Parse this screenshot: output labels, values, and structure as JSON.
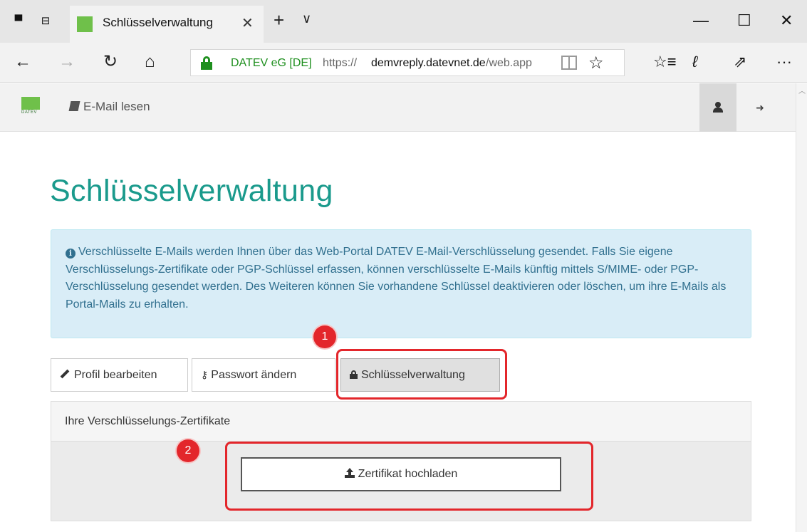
{
  "browser": {
    "tab_title": "Schlüsselverwaltung",
    "tab_close": "✕",
    "new_tab": "+",
    "tab_menu": "∨",
    "window_controls": {
      "minimize": "—",
      "maximize": "☐",
      "close": "✕"
    },
    "nav": {
      "back": "←",
      "forward": "→",
      "refresh": "↻",
      "home": "⌂"
    },
    "address": {
      "org": "DATEV eG [DE]",
      "scheme": "https://",
      "host": "demvreply.datevnet.de",
      "path": "/web.app"
    },
    "favorite_icon": "☆",
    "toolbar": {
      "favorites": "☆≡",
      "notes": "ℓ",
      "share": "⇗",
      "more": "···"
    }
  },
  "app": {
    "logo_text": "DATEV",
    "nav_read_mail": "E-Mail lesen",
    "logout_glyph": "➜"
  },
  "page": {
    "title": "Schlüsselverwaltung",
    "info_icon": "i",
    "info_text": "Verschlüsselte E-Mails werden Ihnen über das Web-Portal DATEV E-Mail-Verschlüsselung gesendet. Falls Sie eigene Verschlüsselungs-Zertifikate oder PGP-Schlüssel erfassen, können verschlüsselte E-Mails künftig mittels S/MIME- oder PGP-Verschlüsselung gesendet werden. Des Weiteren können Sie vorhandene Schlüssel deaktivieren oder löschen, um ihre E-Mails als Portal-Mails zu erhalten.",
    "tabs": [
      {
        "label": "Profil bearbeiten"
      },
      {
        "label": "Passwort ändern",
        "icon_glyph": "⚷"
      },
      {
        "label": "Schlüsselverwaltung",
        "active": true
      }
    ],
    "panel_heading": "Ihre Verschlüsselungs-Zertifikate",
    "upload_button": "Zertifikat hochladen"
  },
  "annotations": {
    "marker_1": "1",
    "marker_2": "2"
  },
  "colors": {
    "title_teal": "#1a9a8c",
    "info_bg": "#d9edf7",
    "info_text": "#31708f",
    "datev_green": "#6fc04a",
    "annotation_red": "#e3262b"
  }
}
